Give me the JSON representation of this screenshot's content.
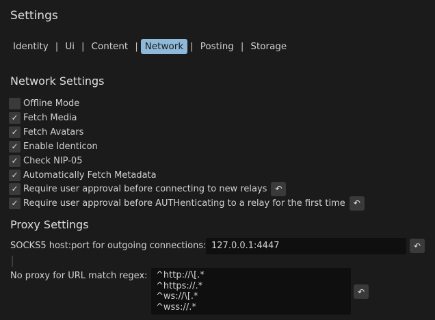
{
  "title": "Settings",
  "tabs": [
    {
      "label": "Identity"
    },
    {
      "label": "Ui"
    },
    {
      "label": "Content"
    },
    {
      "label": "Network",
      "active": true
    },
    {
      "label": "Posting"
    },
    {
      "label": "Storage"
    }
  ],
  "tab_separator": "|",
  "network": {
    "heading": "Network Settings",
    "options": [
      {
        "label": "Offline Mode",
        "checked": false
      },
      {
        "label": "Fetch Media",
        "checked": true
      },
      {
        "label": "Fetch Avatars",
        "checked": true
      },
      {
        "label": "Enable Identicon",
        "checked": true
      },
      {
        "label": "Check NIP-05",
        "checked": true
      },
      {
        "label": "Automatically Fetch Metadata",
        "checked": true
      },
      {
        "label": "Require user approval before connecting to new relays",
        "checked": true,
        "undo": true
      },
      {
        "label": "Require user approval before AUTHenticating to a relay for the first time",
        "checked": true,
        "undo": true
      }
    ]
  },
  "proxy": {
    "heading": "Proxy Settings",
    "socks_label": "SOCKS5 host:port for outgoing connections:",
    "socks_value": "127.0.0.1:4447",
    "noproxy_label": "No proxy for URL match regex:",
    "noproxy_lines": [
      "^http://\\[.*",
      "^https://.*",
      "^ws://\\[.*",
      "^wss://.*"
    ]
  },
  "icons": {
    "check": "check-icon",
    "undo": "undo-icon"
  },
  "glyphs": {
    "check": "✓",
    "undo": "↶"
  },
  "colors": {
    "background": "#1b1b1b",
    "accent": "#8fb9d8",
    "control": "#3a3a3a",
    "input": "#0f0f0f"
  }
}
